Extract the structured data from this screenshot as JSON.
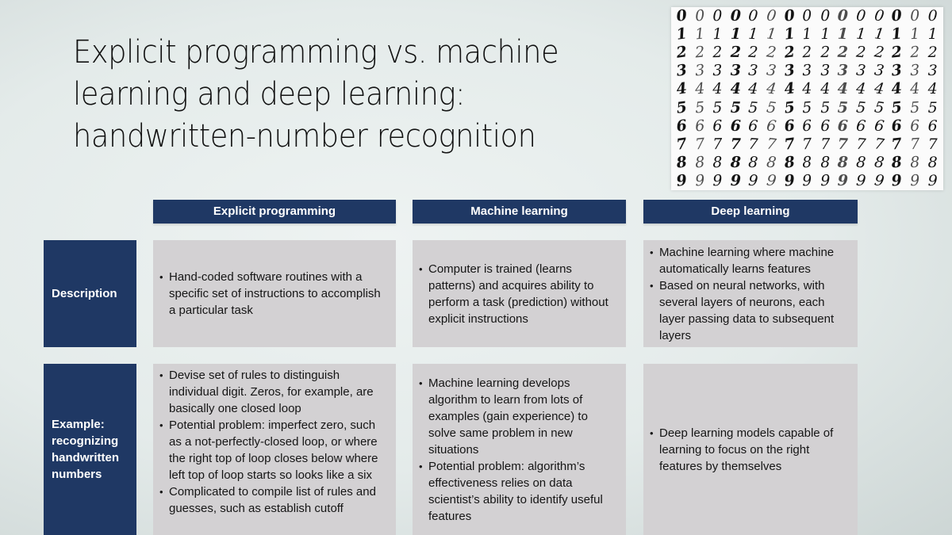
{
  "slide": {
    "title": "Explicit programming vs. machine learning and deep learning: handwritten-number recognition",
    "image": {
      "description": "Grid of handwritten digits 0-9, fifteen samples per row",
      "rows": [
        "000000000000000",
        "111111111111111",
        "222222222222222",
        "333333333333333",
        "444444444444444",
        "555555555555555",
        "666666666666666",
        "777777777777777",
        "888888888888888",
        "999999999999999"
      ]
    },
    "colors": {
      "header_fill": "#1f3864",
      "cell_fill": "#d3d1d3",
      "header_text": "#ffffff"
    }
  },
  "table": {
    "columns": [
      "Explicit programming",
      "Machine learning",
      "Deep learning"
    ],
    "rows": [
      {
        "label": "Description",
        "cells": [
          [
            "Hand-coded software routines with a specific set of instructions to accomplish a particular task"
          ],
          [
            "Computer is trained (learns patterns) and acquires ability to perform a task (prediction) without explicit instructions"
          ],
          [
            "Machine learning where machine automatically learns features",
            "Based on neural networks, with several layers of neurons, each layer passing data to subsequent layers"
          ]
        ]
      },
      {
        "label": "Example: recognizing handwritten numbers",
        "cells": [
          [
            "Devise set of rules to distinguish individual digit. Zeros, for example, are basically one closed loop",
            "Potential problem: imperfect zero, such as a not-perfectly-closed loop, or where the right top of loop closes below where left top of loop starts so looks like a six",
            "Complicated to compile list of rules and guesses,  such as establish cutoff"
          ],
          [
            "Machine learning develops algorithm to learn from lots of examples (gain experience) to solve same problem in new situations",
            "Potential problem: algorithm’s effectiveness relies on data scientist’s ability to identify useful features"
          ],
          [
            "Deep learning models capable of learning to focus on the right features by themselves"
          ]
        ]
      }
    ]
  }
}
